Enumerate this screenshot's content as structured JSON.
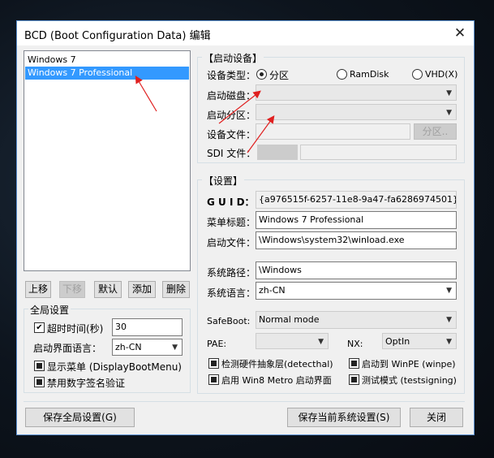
{
  "window": {
    "title": "BCD (Boot Configuration Data) 编辑",
    "close": "✕"
  },
  "entries": [
    {
      "label": "Windows 7",
      "selected": false
    },
    {
      "label": "Windows 7 Professional",
      "selected": true
    }
  ],
  "list_buttons": {
    "up": "上移",
    "down": "下移",
    "default": "默认",
    "add": "添加",
    "delete": "删除"
  },
  "global": {
    "title": "全局设置",
    "timeout_label": "超时时间(秒)",
    "timeout_value": "30",
    "boot_lang_label": "启动界面语言：",
    "boot_lang_value": "zh-CN",
    "display_menu_label": "显示菜单 (DisplayBootMenu)",
    "disable_sig_label": "禁用数字签名验证"
  },
  "boot_device": {
    "title": "【启动设备】",
    "type_label": "设备类型：",
    "radio_partition": "分区",
    "radio_ramdisk": "RamDisk",
    "radio_vhd": "VHD(X)",
    "disk_label": "启动磁盘：",
    "partition_label": "启动分区：",
    "file_label": "设备文件：",
    "partition_button": "分区..",
    "sdi_label": "SDI 文件："
  },
  "settings": {
    "title": "【设置】",
    "guid_label": "G U I D：",
    "guid_value": "{a976515f-6257-11e8-9a47-fa6286974501}",
    "menu_title_label": "菜单标题：",
    "menu_title_value": "Windows 7 Professional",
    "boot_file_label": "启动文件：",
    "boot_file_value": "\\Windows\\system32\\winload.exe",
    "sys_path_label": "系统路径：",
    "sys_path_value": "\\Windows",
    "sys_lang_label": "系统语言：",
    "sys_lang_value": "zh-CN",
    "safeboot_label": "SafeBoot:",
    "safeboot_value": "Normal mode",
    "pae_label": "PAE:",
    "pae_value": "",
    "nx_label": "NX:",
    "nx_value": "OptIn",
    "detecthal_label": "检测硬件抽象层(detecthal)",
    "winpe_label": "启动到 WinPE (winpe)",
    "metro_label": "启用 Win8 Metro 启动界面",
    "testsigning_label": "测试模式 (testsigning)"
  },
  "footer": {
    "save_global": "保存全局设置(G)",
    "save_current": "保存当前系统设置(S)",
    "close": "关闭"
  },
  "icons": {
    "check": "✔",
    "dropdown": "▼"
  },
  "colors": {
    "selection": "#3399ff",
    "annotation": "#e02020",
    "window_border": "#5a8fd0"
  }
}
